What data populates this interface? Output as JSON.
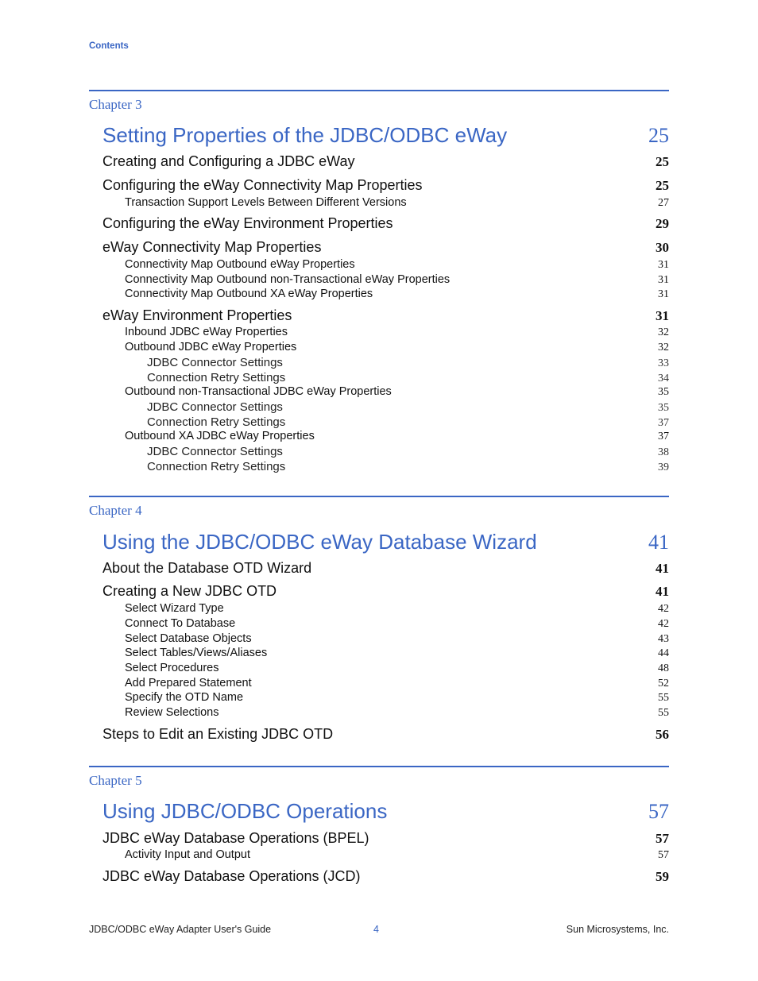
{
  "running_head": "Contents",
  "chapters": [
    {
      "label": "Chapter 3",
      "title": "Setting Properties of the JDBC/ODBC eWay",
      "page": "25",
      "entries": [
        {
          "level": 1,
          "text": "Creating and Configuring a JDBC eWay",
          "page": "25"
        },
        {
          "level": 1,
          "text": "Configuring the eWay Connectivity Map Properties",
          "page": "25"
        },
        {
          "level": 2,
          "text": "Transaction Support Levels Between Different Versions",
          "page": "27"
        },
        {
          "level": 1,
          "text": "Configuring the eWay Environment Properties",
          "page": "29"
        },
        {
          "level": 1,
          "text": "eWay Connectivity Map Properties",
          "page": "30"
        },
        {
          "level": 2,
          "text": "Connectivity Map Outbound eWay Properties",
          "page": "31"
        },
        {
          "level": 2,
          "text": "Connectivity Map Outbound non-Transactional eWay Properties",
          "page": "31"
        },
        {
          "level": 2,
          "text": "Connectivity Map Outbound XA eWay Properties",
          "page": "31"
        },
        {
          "level": 1,
          "text": "eWay Environment Properties",
          "page": "31"
        },
        {
          "level": 2,
          "text": "Inbound JDBC eWay Properties",
          "page": "32"
        },
        {
          "level": 2,
          "text": "Outbound JDBC eWay Properties",
          "page": "32"
        },
        {
          "level": 3,
          "text": "JDBC Connector Settings",
          "page": "33"
        },
        {
          "level": 3,
          "text": "Connection Retry Settings",
          "page": "34"
        },
        {
          "level": 2,
          "text": "Outbound non-Transactional JDBC eWay Properties",
          "page": "35"
        },
        {
          "level": 3,
          "text": "JDBC Connector Settings",
          "page": "35"
        },
        {
          "level": 3,
          "text": "Connection Retry Settings",
          "page": "37"
        },
        {
          "level": 2,
          "text": "Outbound XA JDBC eWay Properties",
          "page": "37"
        },
        {
          "level": 3,
          "text": "JDBC Connector Settings",
          "page": "38"
        },
        {
          "level": 3,
          "text": "Connection Retry Settings",
          "page": "39"
        }
      ]
    },
    {
      "label": "Chapter 4",
      "title": "Using the JDBC/ODBC eWay Database Wizard",
      "page": "41",
      "entries": [
        {
          "level": 1,
          "text": "About the Database OTD Wizard",
          "page": "41"
        },
        {
          "level": 1,
          "text": "Creating a New JDBC OTD",
          "page": "41"
        },
        {
          "level": 2,
          "text": "Select Wizard Type",
          "page": "42"
        },
        {
          "level": 2,
          "text": "Connect To Database",
          "page": "42"
        },
        {
          "level": 2,
          "text": "Select Database Objects",
          "page": "43"
        },
        {
          "level": 2,
          "text": "Select Tables/Views/Aliases",
          "page": "44"
        },
        {
          "level": 2,
          "text": "Select Procedures",
          "page": "48"
        },
        {
          "level": 2,
          "text": "Add Prepared Statement",
          "page": "52"
        },
        {
          "level": 2,
          "text": "Specify the OTD Name",
          "page": "55"
        },
        {
          "level": 2,
          "text": "Review Selections",
          "page": "55"
        },
        {
          "level": 1,
          "text": "Steps to Edit an Existing JDBC OTD",
          "page": "56"
        }
      ]
    },
    {
      "label": "Chapter 5",
      "title": "Using JDBC/ODBC Operations",
      "page": "57",
      "entries": [
        {
          "level": 1,
          "text": "JDBC eWay Database Operations (BPEL)",
          "page": "57"
        },
        {
          "level": 2,
          "text": "Activity Input and Output",
          "page": "57"
        },
        {
          "level": 1,
          "text": "JDBC eWay Database Operations (JCD)",
          "page": "59"
        }
      ]
    }
  ],
  "footer": {
    "left": "JDBC/ODBC eWay Adapter User's Guide",
    "page_number": "4",
    "right": "Sun Microsystems, Inc."
  },
  "colors": {
    "accent": "#3a66c4",
    "text": "#111111"
  }
}
